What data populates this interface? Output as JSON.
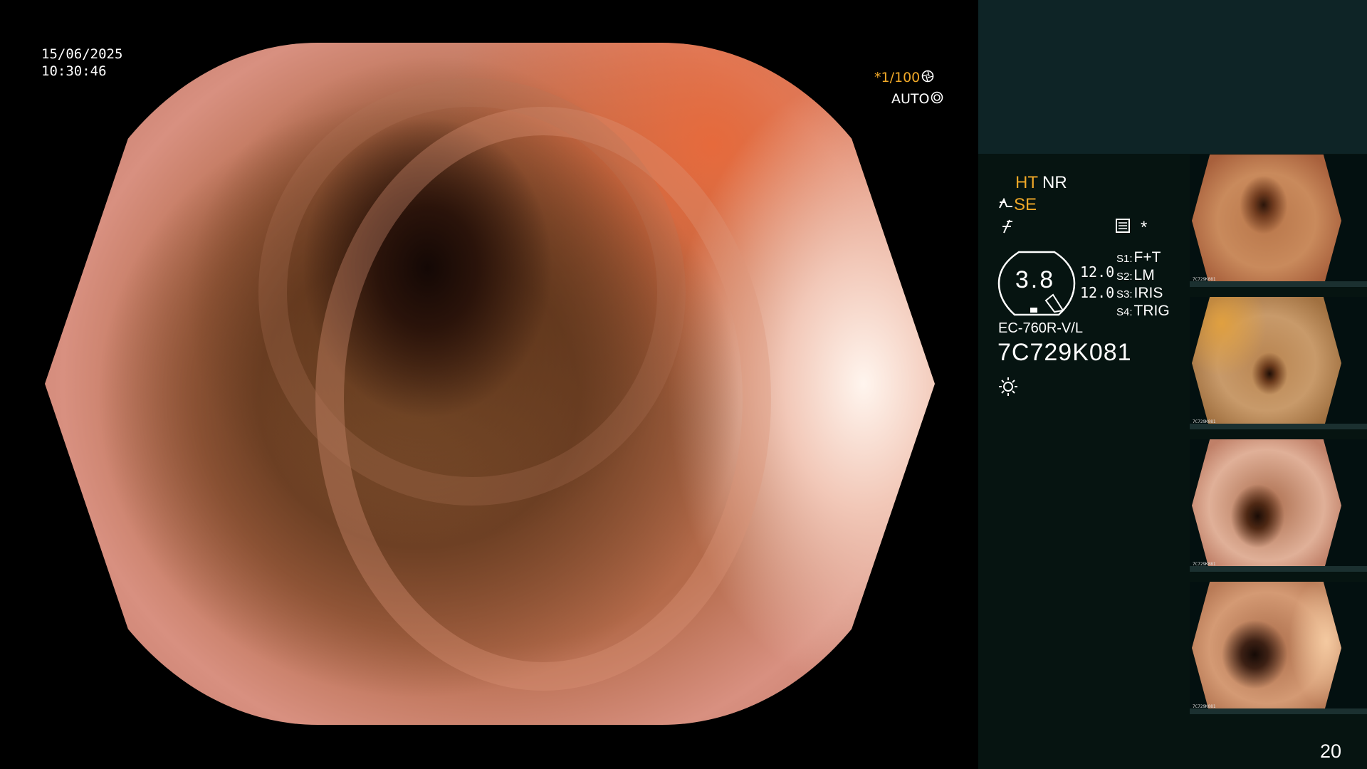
{
  "overlay": {
    "date": "15/06/2025",
    "time": "10:30:46",
    "shutter": "*1/100",
    "iris_mode": "AUTO"
  },
  "info_panel": {
    "ht_label": "HT",
    "nr_label": "NR",
    "se_label": "SE",
    "star": "*",
    "dial_value": "3.8",
    "value_a": "12.0",
    "value_b": "12.0",
    "switches": [
      {
        "key": "S1:",
        "value": "F+T"
      },
      {
        "key": "S2:",
        "value": "LM"
      },
      {
        "key": "S3:",
        "value": "IRIS"
      },
      {
        "key": "S4:",
        "value": "TRIG"
      }
    ],
    "scope_model": "EC-760R-V/L",
    "scope_serial": "7C729K081"
  },
  "thumbnails": [
    {
      "label": "7C729K081"
    },
    {
      "label": "7C729K081"
    },
    {
      "label": "7C729K081"
    },
    {
      "label": "7C729K081"
    }
  ],
  "page_number": "20",
  "colors": {
    "accent_orange": "#f0a828",
    "panel_bg": "#061411",
    "header_bg": "#0e2426"
  },
  "icons": [
    "aperture-icon",
    "iris-icon",
    "enhance-icon",
    "freeze-icon",
    "document-icon",
    "light-icon"
  ]
}
